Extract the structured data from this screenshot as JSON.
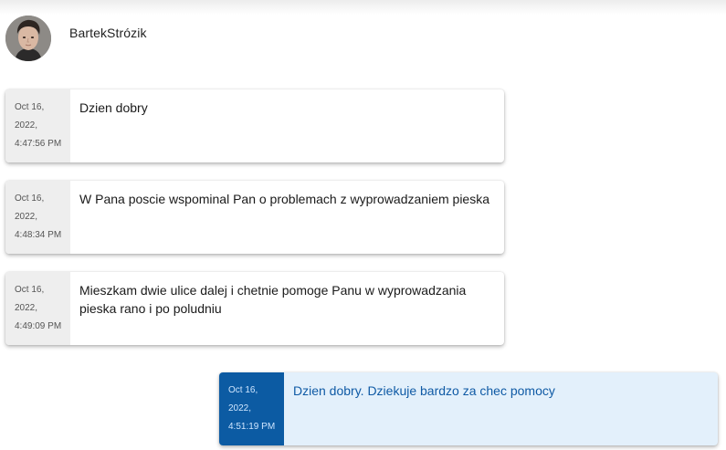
{
  "contact": {
    "name": "BartekStrózik"
  },
  "messages": [
    {
      "direction": "incoming",
      "date": "Oct 16,",
      "year": "2022,",
      "time": "4:47:56 PM",
      "text": "Dzien dobry"
    },
    {
      "direction": "incoming",
      "date": "Oct 16,",
      "year": "2022,",
      "time": "4:48:34 PM",
      "text": "W Pana poscie wspominal Pan o problemach z wyprowadzaniem pieska"
    },
    {
      "direction": "incoming",
      "date": "Oct 16,",
      "year": "2022,",
      "time": "4:49:09 PM",
      "text": "Mieszkam dwie ulice dalej i chetnie pomoge Panu w wyprowadzania pieska rano i po poludniu"
    },
    {
      "direction": "outgoing",
      "date": "Oct 16,",
      "year": "2022,",
      "time": "4:51:19 PM",
      "text": "Dzien dobry. Dziekuje bardzo za chec pomocy"
    }
  ],
  "colors": {
    "outgoing_stamp_bg": "#0c5ba3",
    "outgoing_bubble_bg": "#e3f0fb",
    "incoming_stamp_bg": "#eeeeee"
  }
}
